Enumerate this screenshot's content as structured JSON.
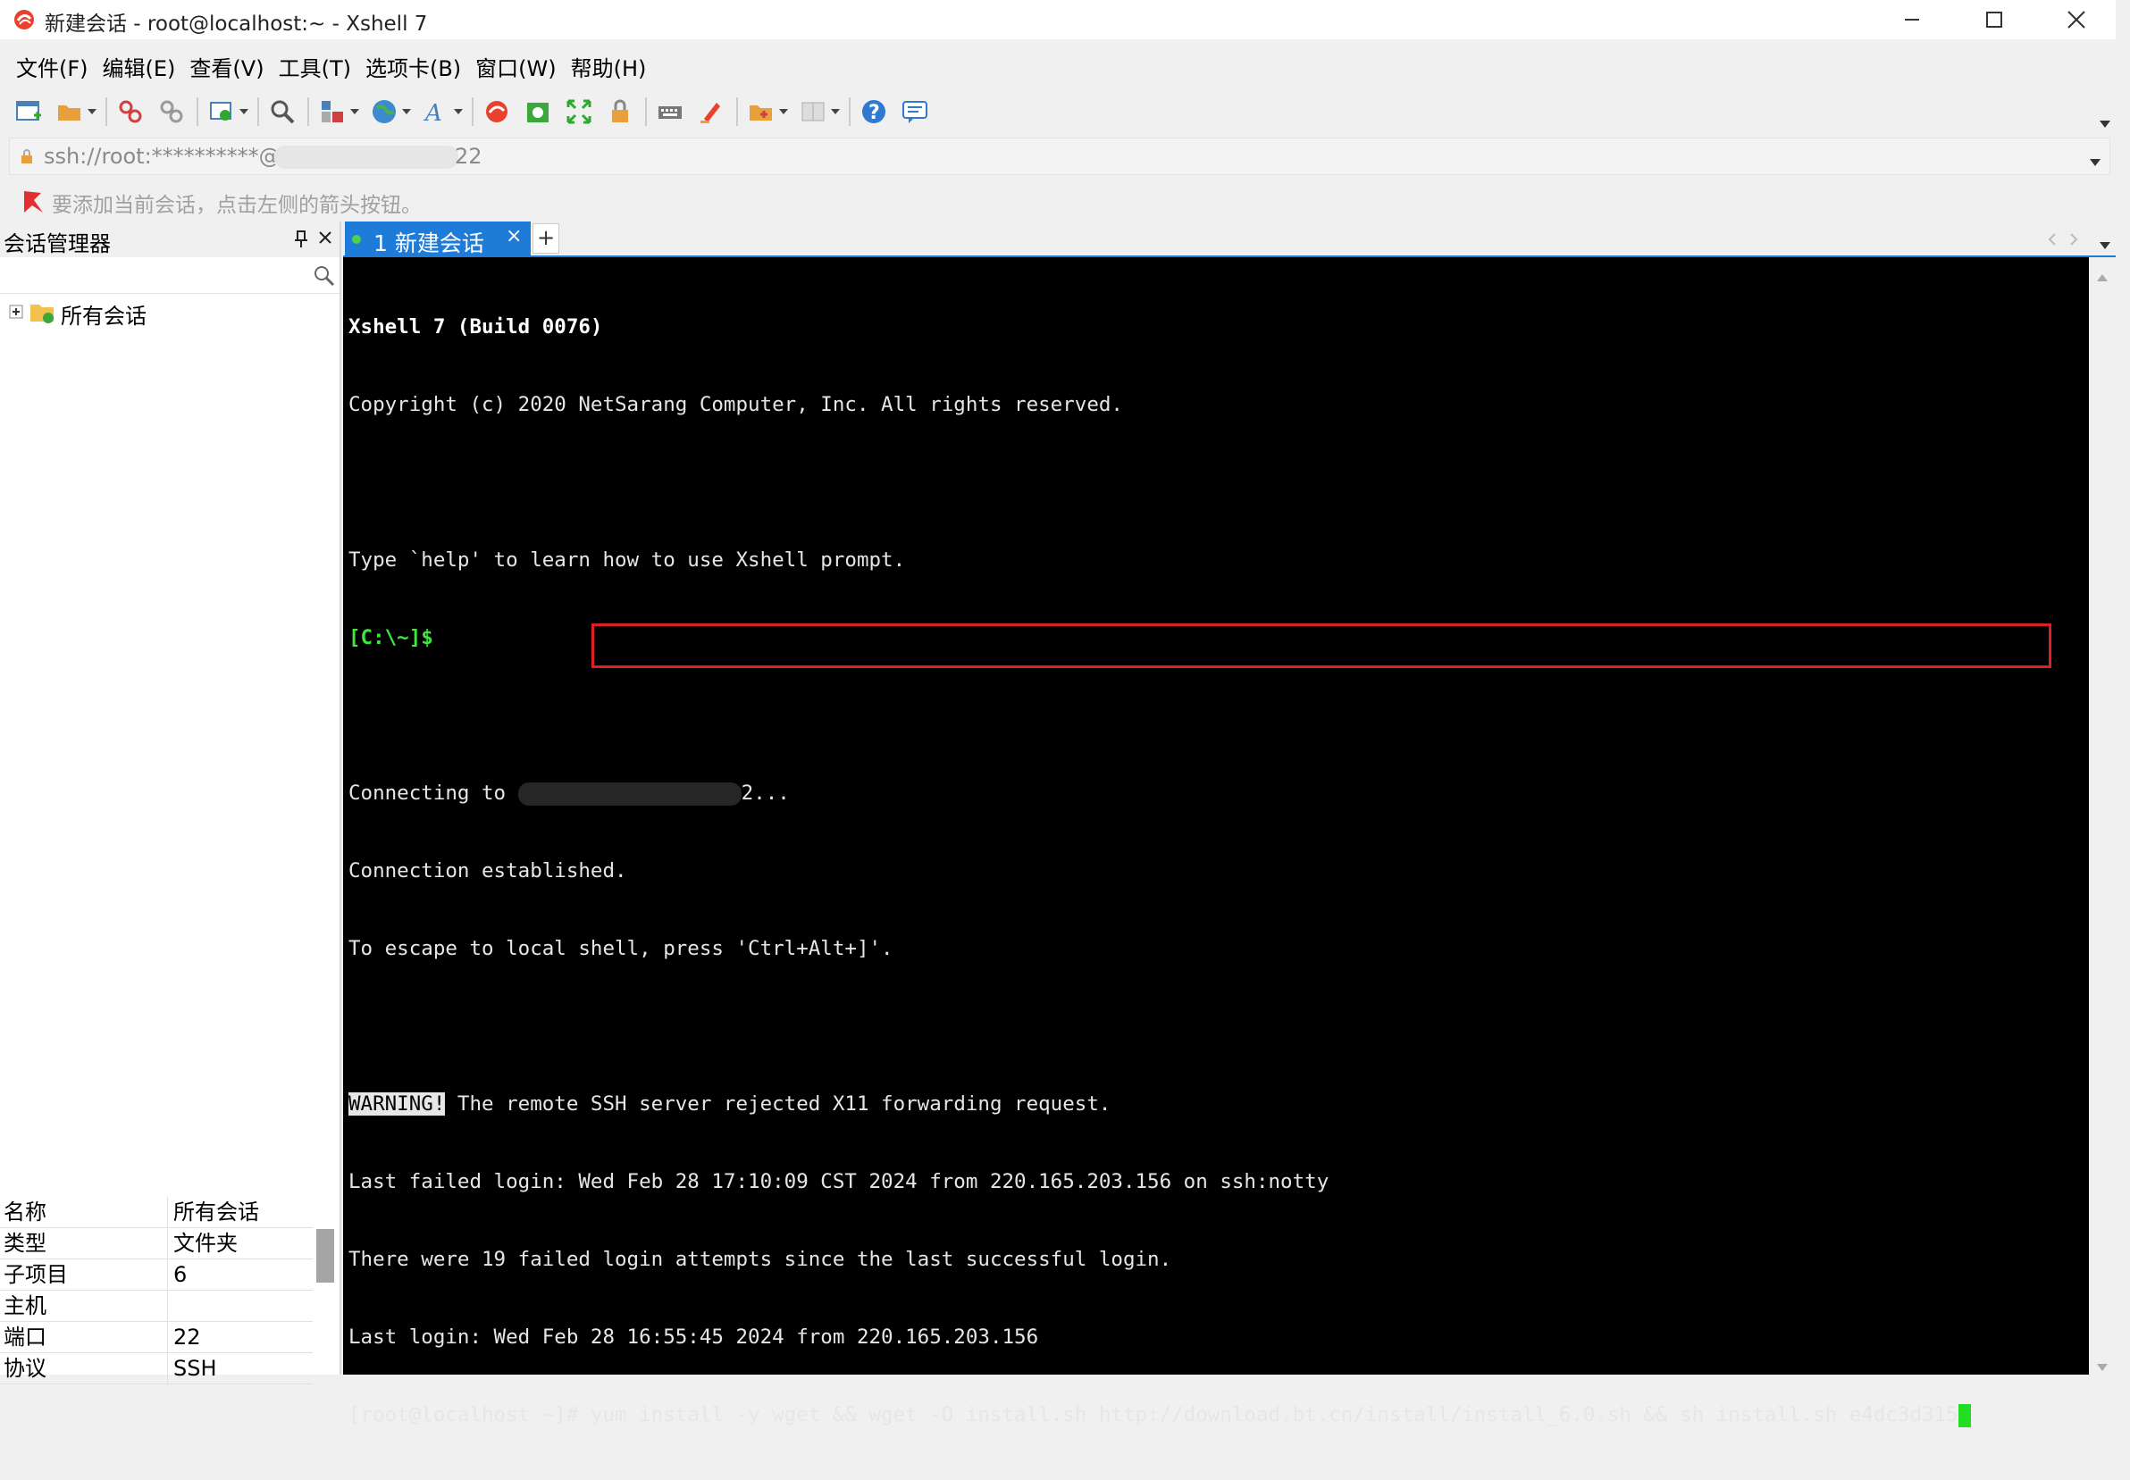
{
  "window": {
    "title": "新建会话 - root@localhost:~ - Xshell 7"
  },
  "menu": [
    "文件(F)",
    "编辑(E)",
    "查看(V)",
    "工具(T)",
    "选项卡(B)",
    "窗口(W)",
    "帮助(H)"
  ],
  "address": {
    "prefix": "ssh://root:**********@",
    "port_suffix": "22"
  },
  "hint": "要添加当前会话，点击左侧的箭头按钮。",
  "session_manager": {
    "title": "会话管理器",
    "tree_root": "所有会话",
    "properties": [
      {
        "name": "名称",
        "value": "所有会话"
      },
      {
        "name": "类型",
        "value": "文件夹"
      },
      {
        "name": "子项目",
        "value": "6"
      },
      {
        "name": "主机",
        "value": ""
      },
      {
        "name": "端口",
        "value": "22"
      },
      {
        "name": "协议",
        "value": "SSH"
      }
    ]
  },
  "tab": {
    "label": "1 新建会话",
    "close": "×",
    "add": "+"
  },
  "terminal": {
    "line1": "Xshell 7 (Build 0076)",
    "line2": "Copyright (c) 2020 NetSarang Computer, Inc. All rights reserved.",
    "line3": "",
    "line4": "Type `help' to learn how to use Xshell prompt.",
    "prompt_local": "[C:\\~]$",
    "line6": "",
    "connecting_prefix": "Connecting to ",
    "connecting_suffix": "2...",
    "line8": "Connection established.",
    "line9": "To escape to local shell, press 'Ctrl+Alt+]'.",
    "line10": "",
    "warning_tag": "WARNING!",
    "warning_rest": " The remote SSH server rejected X11 forwarding request.",
    "line12": "Last failed login: Wed Feb 28 17:10:09 CST 2024 from 220.165.203.156 on ssh:notty",
    "line13": "There were 19 failed login attempts since the last successful login.",
    "line14": "Last login: Wed Feb 28 16:55:45 2024 from 220.165.203.156",
    "shell_prompt": "[root@localhost ~]# ",
    "command": "yum install -y wget && wget -O install.sh http://download.bt.cn/install/install_6.0.sh && sh install.sh e4dc3d315"
  },
  "colors": {
    "tab_active": "#1e7bd8",
    "terminal_bg": "#000000",
    "prompt_green": "#3ee63e",
    "cursor": "#22dd22",
    "highlight_box": "#e02020"
  }
}
